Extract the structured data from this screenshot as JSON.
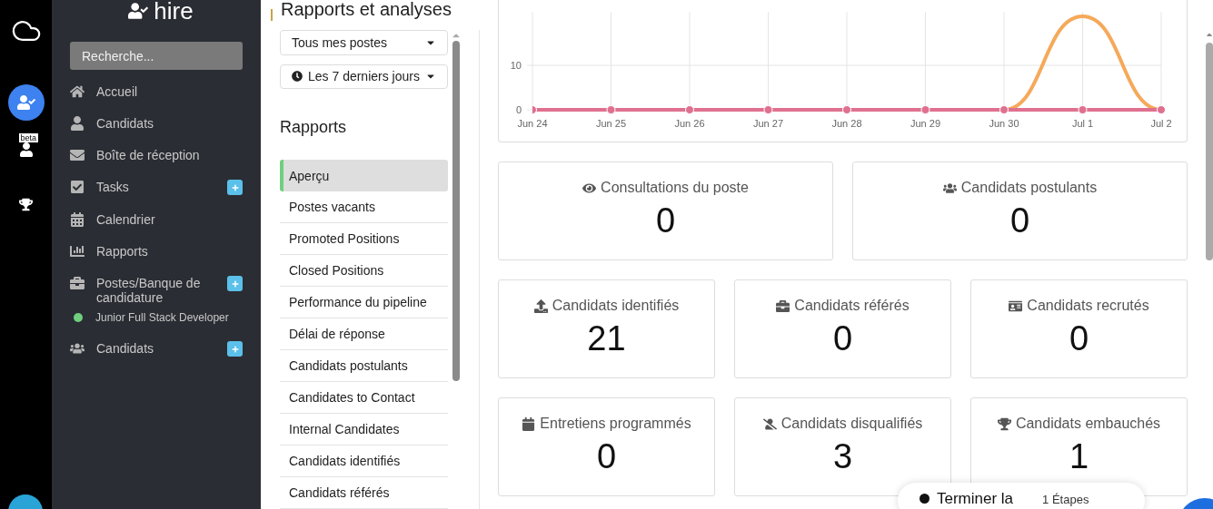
{
  "rail": {
    "items": [
      {
        "selected": false
      },
      {
        "selected": true
      },
      {
        "selected": false,
        "badge": "beta"
      },
      {
        "selected": false
      }
    ]
  },
  "sidebar": {
    "logo": "hire",
    "search": {
      "placeholder": "Recherche..."
    },
    "items": [
      {
        "label": "Accueil",
        "add": false
      },
      {
        "label": "Candidats",
        "add": false
      },
      {
        "label": "Boîte de réception",
        "add": false
      },
      {
        "label": "Tasks",
        "add": true
      },
      {
        "label": "Calendrier",
        "add": false
      },
      {
        "label": "Rapports",
        "add": false
      },
      {
        "label": "Postes/Banque de candidature",
        "add": true,
        "children": [
          {
            "label": "Junior Full Stack Developer",
            "color": "#6fcf7f"
          }
        ]
      },
      {
        "label": "Candidats",
        "add": true
      }
    ]
  },
  "page": {
    "title": "Rapports et analyses"
  },
  "filters": [
    {
      "label": "Tous mes postes",
      "clock": false
    },
    {
      "label": "Les 7 derniers jours",
      "clock": true
    }
  ],
  "reports": {
    "heading": "Rapports",
    "items": [
      {
        "label": "Aperçu",
        "selected": true
      },
      {
        "label": "Postes vacants",
        "selected": false
      },
      {
        "label": "Promoted Positions",
        "selected": false
      },
      {
        "label": "Closed Positions",
        "selected": false
      },
      {
        "label": "Performance du pipeline",
        "selected": false
      },
      {
        "label": "Délai de réponse",
        "selected": false
      },
      {
        "label": "Candidats postulants",
        "selected": false
      },
      {
        "label": "Candidates to Contact",
        "selected": false
      },
      {
        "label": "Internal Candidates",
        "selected": false
      },
      {
        "label": "Candidats identifiés",
        "selected": false
      },
      {
        "label": "Candidats référés",
        "selected": false
      }
    ]
  },
  "chart_data": {
    "type": "line",
    "categories": [
      "Jun 24",
      "Jun 25",
      "Jun 26",
      "Jun 27",
      "Jun 28",
      "Jun 29",
      "Jun 30",
      "Jul 1",
      "Jul 2"
    ],
    "ylim": [
      0,
      22
    ],
    "yticks": [
      0,
      10
    ],
    "grid": true,
    "series": [
      {
        "color": "#f5a95a",
        "marker": false,
        "values": [
          null,
          null,
          null,
          null,
          null,
          null,
          0,
          21,
          0
        ]
      },
      {
        "color": "#e0708f",
        "marker": true,
        "values": [
          0,
          0,
          0,
          0,
          0,
          0,
          0,
          0,
          0
        ]
      }
    ]
  },
  "stats": [
    {
      "label": "Consultations du poste",
      "value": "0"
    },
    {
      "label": "Candidats postulants",
      "value": "0"
    },
    {
      "label": "Candidats identifiés",
      "value": "21"
    },
    {
      "label": "Candidats référés",
      "value": "0"
    },
    {
      "label": "Candidats recrutés",
      "value": "0"
    },
    {
      "label": "Entretiens programmés",
      "value": "0"
    },
    {
      "label": "Candidats disqualifiés",
      "value": "3"
    },
    {
      "label": "Candidats embauchés",
      "value": "1"
    }
  ],
  "guide": {
    "label": "Terminer la",
    "steps": "1 Étapes"
  }
}
